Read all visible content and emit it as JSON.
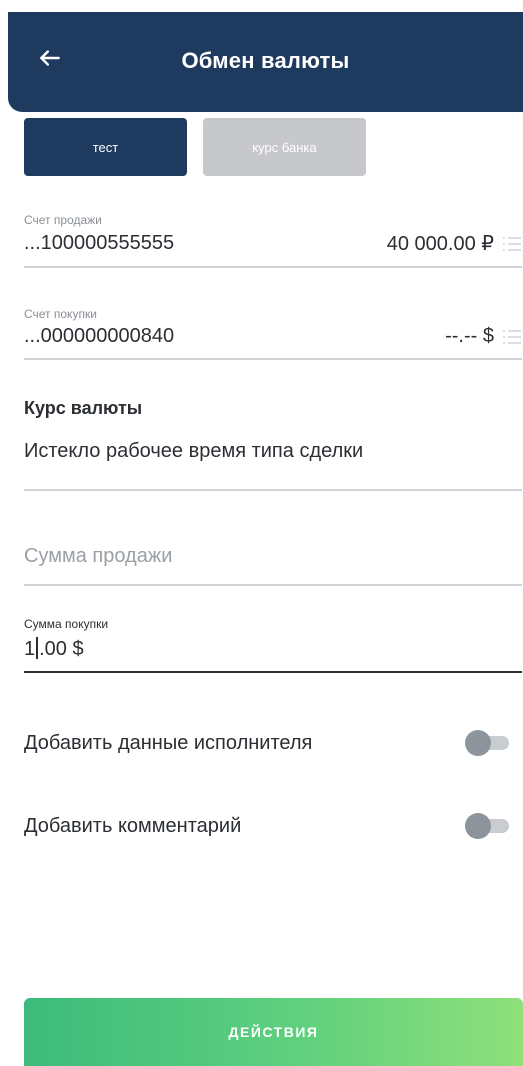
{
  "header": {
    "title": "Обмен валюты"
  },
  "tabs": [
    {
      "label": "тест",
      "active": true
    },
    {
      "label": "курс банка",
      "active": false
    }
  ],
  "sell_account": {
    "label": "Счет продажи",
    "number": "...100000555555",
    "balance": "40 000.00 ₽"
  },
  "buy_account": {
    "label": "Счет покупки",
    "number": "...000000000840",
    "balance": "--.-- $"
  },
  "rate": {
    "title": "Курс валюты",
    "value": "Истекло рабочее время типа сделки"
  },
  "sell_amount": {
    "placeholder": "Сумма продажи"
  },
  "buy_amount": {
    "label": "Сумма покупки",
    "value_before_caret": "1",
    "value_after_caret": ".00 $"
  },
  "toggles": [
    {
      "label": "Добавить данные исполнителя",
      "on": false
    },
    {
      "label": "Добавить комментарий",
      "on": false
    }
  ],
  "action_button": {
    "label": "ДЕЙСТВИЯ"
  },
  "colors": {
    "header": "#1f3a5f",
    "tab_active": "#1f3a5f",
    "tab_inactive": "#c6c8cc",
    "button_gradient_start": "#3dbb7c",
    "button_gradient_end": "#8fe07a"
  },
  "icons": {
    "back": "arrow-left-icon",
    "account_list": "list-icon"
  }
}
